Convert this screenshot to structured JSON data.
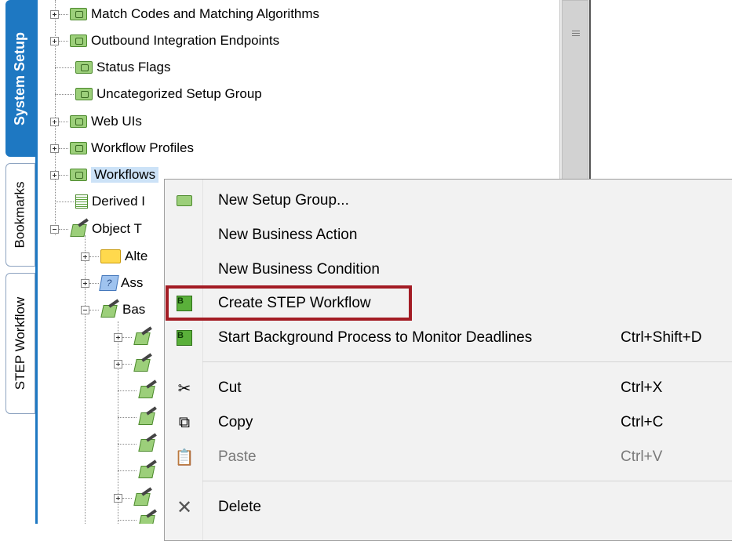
{
  "tabs": [
    {
      "label": "System Setup",
      "active": true
    },
    {
      "label": "Bookmarks",
      "active": false
    },
    {
      "label": "STEP Workflow",
      "active": false
    }
  ],
  "tree": {
    "items": [
      {
        "label": "Match Codes and Matching Algorithms",
        "icon": "setup-group-icon",
        "expander": "plus"
      },
      {
        "label": "Outbound Integration Endpoints",
        "icon": "setup-group-icon",
        "expander": "plus"
      },
      {
        "label": "Status Flags",
        "icon": "setup-group-icon",
        "expander": "none"
      },
      {
        "label": "Uncategorized Setup Group",
        "icon": "setup-group-icon",
        "expander": "none"
      },
      {
        "label": "Web UIs",
        "icon": "setup-group-icon",
        "expander": "plus"
      },
      {
        "label": "Workflow Profiles",
        "icon": "setup-group-icon",
        "expander": "plus"
      },
      {
        "label": "Workflows",
        "icon": "setup-group-icon",
        "expander": "plus",
        "selected": true
      },
      {
        "label": "Derived I",
        "icon": "document-icon",
        "expander": "none"
      },
      {
        "label": "Object T",
        "icon": "object-type-icon",
        "expander": "minus"
      },
      {
        "label": "Alte",
        "icon": "folder-icon",
        "expander": "plus"
      },
      {
        "label": "Ass",
        "icon": "question-icon",
        "expander": "plus"
      },
      {
        "label": "Bas",
        "icon": "object-type-icon",
        "expander": "minus"
      }
    ]
  },
  "context_menu": {
    "items": [
      {
        "label": "New Setup Group...",
        "icon": "setup-group-icon",
        "shortcut": ""
      },
      {
        "label": "New Business Action",
        "icon": "",
        "shortcut": ""
      },
      {
        "label": "New Business Condition",
        "icon": "",
        "shortcut": ""
      },
      {
        "label": "Create STEP Workflow",
        "icon": "workflow-icon",
        "shortcut": "",
        "highlighted": true
      },
      {
        "label": "Start Background Process to Monitor Deadlines",
        "icon": "workflow-icon",
        "shortcut": "Ctrl+Shift+D"
      },
      {
        "label": "Cut",
        "icon": "scissors-icon",
        "shortcut": "Ctrl+X"
      },
      {
        "label": "Copy",
        "icon": "copy-icon",
        "shortcut": "Ctrl+C"
      },
      {
        "label": "Paste",
        "icon": "paste-icon",
        "shortcut": "Ctrl+V",
        "disabled": true
      },
      {
        "label": "Delete",
        "icon": "delete-icon",
        "shortcut": ""
      }
    ]
  },
  "colors": {
    "tab_active": "#1e78c2",
    "highlight_box": "#a31c24",
    "selection": "#cce2f7"
  }
}
